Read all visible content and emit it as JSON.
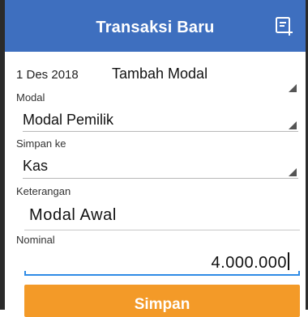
{
  "appbar": {
    "title": "Transaksi Baru",
    "action_icon": "add-note-icon"
  },
  "form": {
    "date": "1 Des 2018",
    "jenis": "Tambah Modal",
    "modal_label": "Modal",
    "modal_value": "Modal Pemilik",
    "simpan_ke_label": "Simpan ke",
    "simpan_ke_value": "Kas",
    "keterangan_label": "Keterangan",
    "keterangan_value": "Modal Awal",
    "nominal_label": "Nominal",
    "nominal_value": "4.000.000"
  },
  "actions": {
    "save_label": "Simpan"
  },
  "colors": {
    "primary": "#3e6fbf",
    "accent": "#f39a28",
    "focus": "#2e8be6"
  }
}
